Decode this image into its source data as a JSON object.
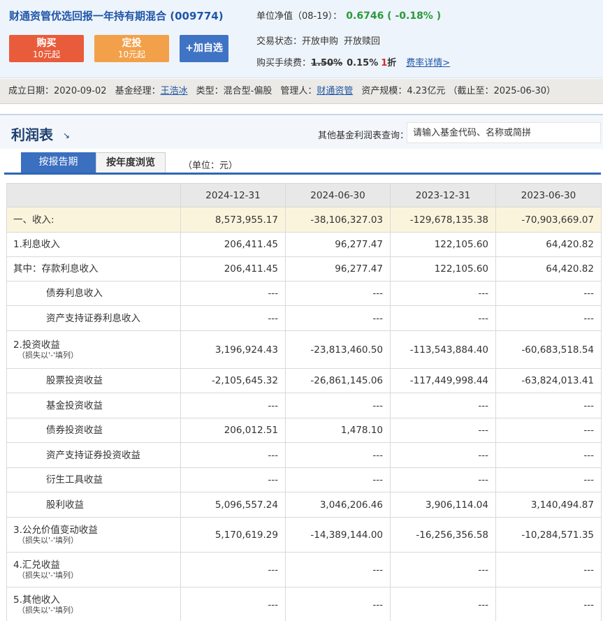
{
  "fund": {
    "title": "财通资管优选回报一年持有期混合 (009774)",
    "buttons": {
      "buy_label": "购买",
      "buy_sub": "10元起",
      "plan_label": "定投",
      "plan_sub": "10元起",
      "fav_label": "+加自选"
    },
    "nav_label": "单位净值（08-19）：",
    "nav_value": "0.6746 ( -0.18% )",
    "status_label": "交易状态：",
    "status_purchase": "开放申购",
    "status_redeem": "开放赎回",
    "fee_label": "购买手续费：",
    "fee_original": "1.50%",
    "fee_current": "0.15%",
    "fee_discount": "1",
    "fee_discount_unit": "折",
    "fee_link": "费率详情>"
  },
  "info_bar": {
    "establish_label": "成立日期：",
    "establish_date": "2020-09-02",
    "manager_label": "基金经理：",
    "manager_name": "王浩冰",
    "type_label": "类型：",
    "type_value": "混合型-偏股",
    "custodian_label": "管理人：",
    "custodian_name": "财通资管",
    "scale_label": "资产规模：",
    "scale_value": "4.23亿元 （截止至：2025-06-30）"
  },
  "section": {
    "title": "利润表",
    "arrow": "↘",
    "query_label": "其他基金利润表查询：",
    "query_placeholder": "请输入基金代码、名称或简拼",
    "tabs": [
      "按报告期",
      "按年度浏览"
    ],
    "unit_note": "（单位：元）"
  },
  "table": {
    "headers": [
      "",
      "2024-12-31",
      "2024-06-30",
      "2023-12-31",
      "2023-06-30"
    ],
    "rows": [
      {
        "label": "一、收入:",
        "note": "",
        "values": [
          "8,573,955.17",
          "-38,106,327.03",
          "-129,678,135.38",
          "-70,903,669.07"
        ]
      },
      {
        "label": "1.利息收入",
        "note": "",
        "values": [
          "206,411.45",
          "96,277.47",
          "122,105.60",
          "64,420.82"
        ]
      },
      {
        "label": "其中：存款利息收入",
        "note": "",
        "values": [
          "206,411.45",
          "96,277.47",
          "122,105.60",
          "64,420.82"
        ]
      },
      {
        "label": "债券利息收入",
        "note": "",
        "values": [
          "---",
          "---",
          "---",
          "---"
        ]
      },
      {
        "label": "资产支持证券利息收入",
        "note": "",
        "values": [
          "---",
          "---",
          "---",
          "---"
        ]
      },
      {
        "label": "2.投资收益",
        "note": "（损失以'-'填列）",
        "values": [
          "3,196,924.43",
          "-23,813,460.50",
          "-113,543,884.40",
          "-60,683,518.54"
        ]
      },
      {
        "label": "股票投资收益",
        "note": "",
        "values": [
          "-2,105,645.32",
          "-26,861,145.06",
          "-117,449,998.44",
          "-63,824,013.41"
        ]
      },
      {
        "label": "基金投资收益",
        "note": "",
        "values": [
          "---",
          "---",
          "---",
          "---"
        ]
      },
      {
        "label": "债券投资收益",
        "note": "",
        "values": [
          "206,012.51",
          "1,478.10",
          "---",
          "---"
        ]
      },
      {
        "label": "资产支持证券投资收益",
        "note": "",
        "values": [
          "---",
          "---",
          "---",
          "---"
        ]
      },
      {
        "label": "衍生工具收益",
        "note": "",
        "values": [
          "---",
          "---",
          "---",
          "---"
        ]
      },
      {
        "label": "股利收益",
        "note": "",
        "values": [
          "5,096,557.24",
          "3,046,206.46",
          "3,906,114.04",
          "3,140,494.87"
        ]
      },
      {
        "label": "3.公允价值变动收益",
        "note": "（损失以'-'填列）",
        "values": [
          "5,170,619.29",
          "-14,389,144.00",
          "-16,256,356.58",
          "-10,284,571.35"
        ]
      },
      {
        "label": "4.汇兑收益",
        "note": "（损失以'-'填列）",
        "values": [
          "---",
          "---",
          "---",
          "---"
        ]
      },
      {
        "label": "5.其他收入",
        "note": "（损失以'-'填列）",
        "values": [
          "---",
          "---",
          "---",
          "---"
        ]
      }
    ]
  },
  "colors": {
    "buy_button": "#e85c3b",
    "plan_button": "#f2a14a",
    "fav_button": "#3f73c4",
    "nav_value": "#2a9a3a",
    "discount": "#d62b2b",
    "highlight_row": "#fbf4dd"
  }
}
